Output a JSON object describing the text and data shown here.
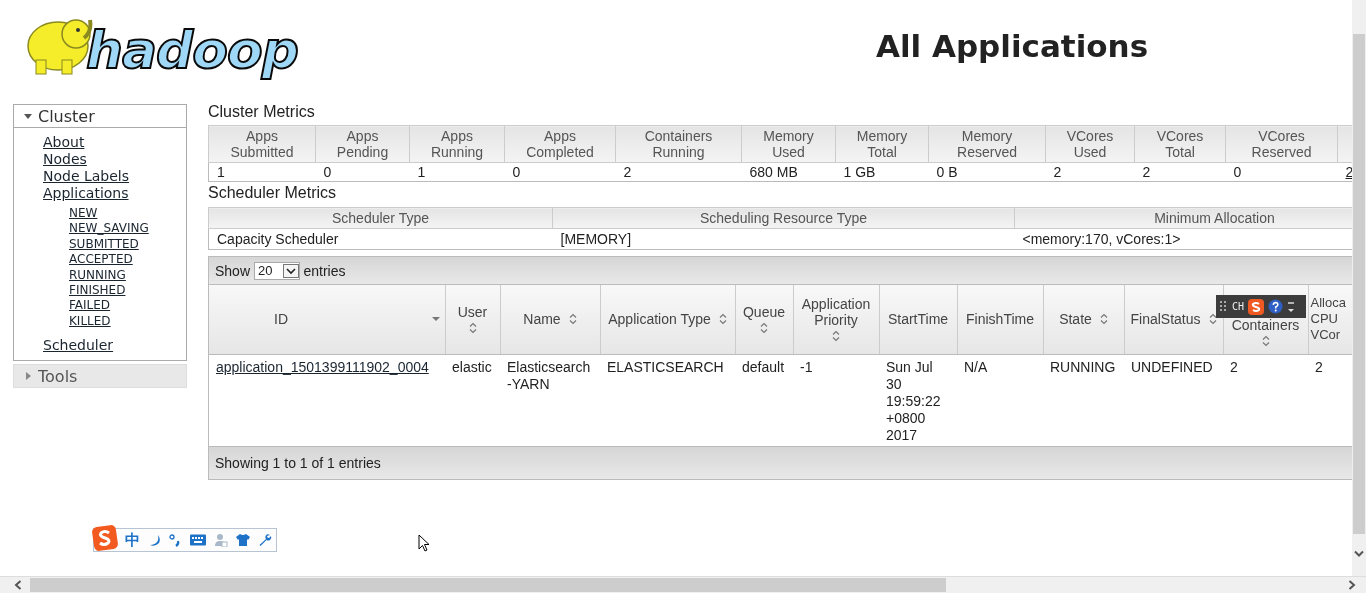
{
  "logo": {
    "text": "hadoop"
  },
  "title": "All Applications",
  "sidebar": {
    "sections": [
      {
        "label": "Cluster",
        "expanded": true,
        "items": [
          {
            "label": "About"
          },
          {
            "label": "Nodes"
          },
          {
            "label": "Node Labels"
          },
          {
            "label": "Applications",
            "children": [
              {
                "label": "NEW"
              },
              {
                "label": "NEW_SAVING"
              },
              {
                "label": "SUBMITTED"
              },
              {
                "label": "ACCEPTED"
              },
              {
                "label": "RUNNING"
              },
              {
                "label": "FINISHED"
              },
              {
                "label": "FAILED"
              },
              {
                "label": "KILLED"
              }
            ]
          },
          {
            "label": "Scheduler"
          }
        ]
      },
      {
        "label": "Tools",
        "expanded": false
      }
    ]
  },
  "cluster_metrics": {
    "title": "Cluster Metrics",
    "columns": [
      "Apps Submitted",
      "Apps Pending",
      "Apps Running",
      "Apps Completed",
      "Containers Running",
      "Memory Used",
      "Memory Total",
      "Memory Reserved",
      "VCores Used",
      "VCores Total",
      "VCores Reserved"
    ],
    "values": [
      "1",
      "0",
      "1",
      "0",
      "2",
      "680 MB",
      "1 GB",
      "0 B",
      "2",
      "2",
      "0",
      "2"
    ]
  },
  "scheduler_metrics": {
    "title": "Scheduler Metrics",
    "columns": [
      "Scheduler Type",
      "Scheduling Resource Type",
      "Minimum Allocation"
    ],
    "rows": [
      [
        "Capacity Scheduler",
        "[MEMORY]",
        "<memory:170, vCores:1>"
      ]
    ]
  },
  "applications": {
    "show_label": "Show",
    "page_size": "20",
    "entries_label": "entries",
    "columns": [
      {
        "label": "ID",
        "sortable": false,
        "sorted_descending": true,
        "kind": "link"
      },
      {
        "label": "User",
        "sortable": true,
        "sorted_descending": false,
        "kind": "text"
      },
      {
        "label": "Name",
        "sortable": true,
        "sorted_descending": false,
        "kind": "text"
      },
      {
        "label": "Application Type",
        "sortable": true,
        "sorted_descending": false,
        "kind": "text"
      },
      {
        "label": "Queue",
        "sortable": true,
        "sorted_descending": false,
        "kind": "text"
      },
      {
        "label": "Application Priority",
        "sortable": true,
        "sorted_descending": false,
        "kind": "text"
      },
      {
        "label": "StartTime",
        "sortable": false,
        "sorted_descending": false,
        "kind": "text"
      },
      {
        "label": "FinishTime",
        "sortable": false,
        "sorted_descending": false,
        "kind": "text"
      },
      {
        "label": "State",
        "sortable": true,
        "sorted_descending": false,
        "kind": "text"
      },
      {
        "label": "FinalStatus",
        "sortable": true,
        "sorted_descending": false,
        "kind": "text"
      },
      {
        "label": "Containers",
        "sortable": true,
        "sorted_descending": false,
        "kind": "text"
      },
      {
        "label": "Alloca CPU VCor",
        "sortable": false,
        "sorted_descending": false,
        "kind": "text"
      }
    ],
    "rows": [
      [
        "application_1501399111902_0004",
        "elastic",
        "Elasticsearch -YARN",
        "ELASTICSEARCH",
        "default",
        "-1",
        "Sun Jul 30 19:59:22 +0800 2017",
        "N/A",
        "RUNNING",
        "UNDEFINED",
        "2",
        "2"
      ]
    ],
    "footer": "Showing 1 to 1 of 1 entries"
  },
  "ime_status_bar": {
    "mode": "CH"
  },
  "ime_toolbar": {
    "mode": "中"
  }
}
